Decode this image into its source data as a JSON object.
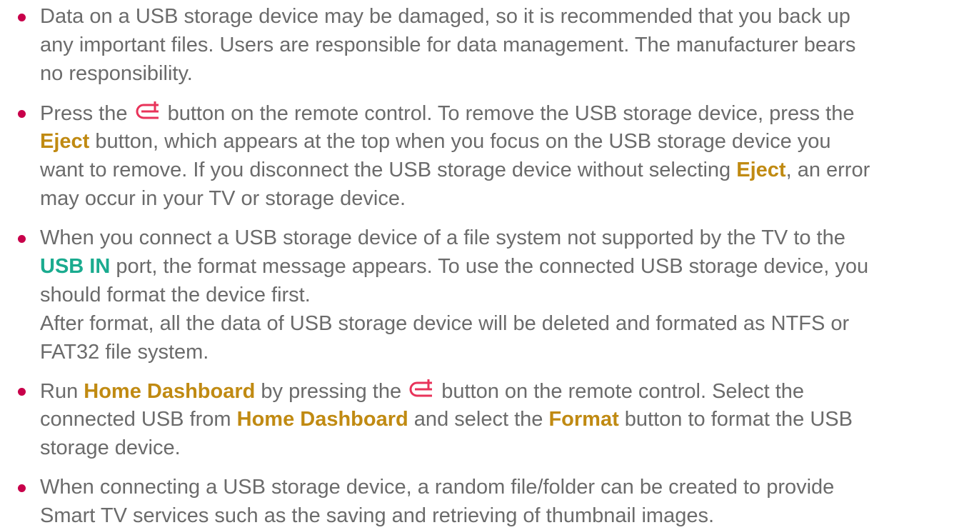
{
  "notes": {
    "item1": {
      "l1": "Data on a USB storage device may be damaged, so it is recommended that you back up",
      "l2": "any important files. Users are responsible for data management. The manufacturer bears",
      "l3": "no responsibility."
    },
    "item2": {
      "l1a": "Press the ",
      "l1b": " button on the remote control. To remove the USB storage device, press the",
      "l2kw": "Eject",
      "l2b": " button, which appears at the top when you focus on the USB storage device you",
      "l3a": "want to remove. If you disconnect the USB storage device without selecting ",
      "l3kw": "Eject",
      "l3b": ", an error",
      "l4": "may occur in your TV or storage device."
    },
    "item3": {
      "l1": "When you connect a USB storage device of a file system not supported by the TV to the",
      "l2kw": "USB IN",
      "l2b": " port, the format message appears. To use the connected USB storage device, you",
      "l3": "should format the device first.",
      "l4": "After format, all the data of USB storage device will be deleted and formated as NTFS or",
      "l5": "FAT32 file system."
    },
    "item4": {
      "l1a": "Run ",
      "l1kw": "Home Dashboard",
      "l1b": " by pressing the ",
      "l1c": " button on the remote control. Select the",
      "l2a": "connected USB from ",
      "l2kw1": "Home Dashboard",
      "l2b": " and select the ",
      "l2kw2": "Format",
      "l2c": " button to format the USB",
      "l3": "storage device."
    },
    "item5": {
      "l1": "When connecting a USB storage device, a random file/folder can be created to provide",
      "l2": "Smart TV services such as the saving and retrieving of thumbnail images."
    }
  },
  "icons": {
    "remote_button": "home-input-icon"
  },
  "colors": {
    "text": "#6b6b6b",
    "bullet": "#c8004a",
    "keyword": "#c08a12",
    "port": "#1aab8f",
    "icon": "#e8335a"
  }
}
